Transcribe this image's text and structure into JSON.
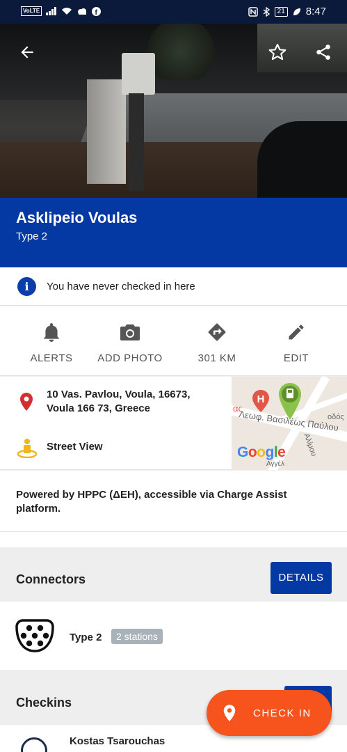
{
  "status_bar": {
    "carrier": "VoLTE",
    "battery": "21",
    "time": "8:47"
  },
  "station": {
    "name": "Asklipeio Voulas",
    "type": "Type 2"
  },
  "notice": {
    "text": "You have never checked in here"
  },
  "actions": [
    {
      "label": "ALERTS",
      "icon": "bell-icon"
    },
    {
      "label": "ADD PHOTO",
      "icon": "camera-icon"
    },
    {
      "label": "301 KM",
      "icon": "directions-icon"
    },
    {
      "label": "EDIT",
      "icon": "pencil-icon"
    }
  ],
  "address": {
    "line1": "10 Vas. Pavlou, Voula, 16673,",
    "line2": "Voula 166 73, Greece",
    "street_view": "Street View"
  },
  "map": {
    "street_label": "Λεωφ. Βασιλέως Παύλου",
    "top_label": "οδός",
    "vertical_label": "Αλίμου",
    "fragment_label": "ας",
    "bottom_label": "Αγγέλ",
    "google_logo": [
      "G",
      "o",
      "o",
      "g",
      "l",
      "e"
    ],
    "google_colors": [
      "#4285F4",
      "#EA4335",
      "#FBBC05",
      "#4285F4",
      "#34A853",
      "#EA4335"
    ],
    "hospital_letter": "H"
  },
  "description": "Powered by HPPC (ΔΕΗ), accessible via Charge Assist platform.",
  "connectors": {
    "title": "Connectors",
    "details_label": "DETAILS",
    "items": [
      {
        "type": "Type 2",
        "count": "2 stations"
      }
    ]
  },
  "checkins": {
    "title": "Checkins",
    "first_user": "Kostas Tsarouchas"
  },
  "fab": {
    "label": "CHECK IN"
  },
  "colors": {
    "brand": "#0439a4",
    "accent": "#f7531d"
  }
}
